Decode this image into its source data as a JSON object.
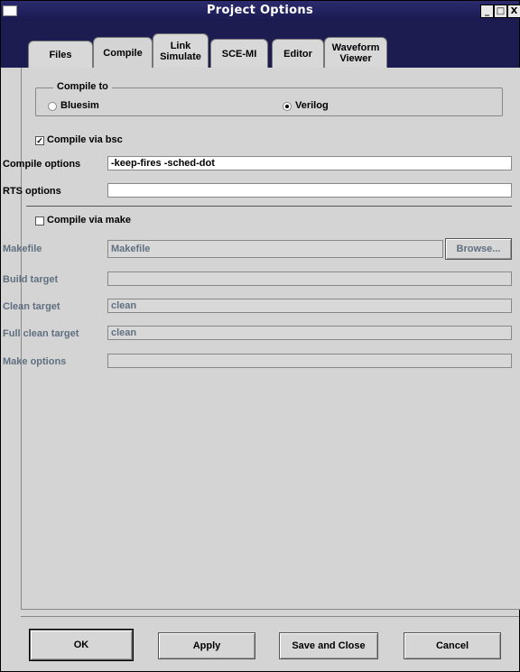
{
  "window": {
    "title": "Project Options",
    "controls": [
      "_",
      "□",
      "X"
    ]
  },
  "tabs": [
    {
      "label": "Files",
      "active": false
    },
    {
      "label": "Compile",
      "active": true
    },
    {
      "label": "Link Simulate",
      "active": false
    },
    {
      "label": "SCE-MI",
      "active": false
    },
    {
      "label": "Editor",
      "active": false
    },
    {
      "label": "Waveform Viewer",
      "active": false
    }
  ],
  "compile_to": {
    "legend": "Compile to",
    "option_bluesim": "Bluesim",
    "option_verilog": "Verilog",
    "selected": "Verilog"
  },
  "compile_via_bsc": {
    "label": "Compile via bsc",
    "checked": true,
    "check_mark": "✓"
  },
  "compile_options": {
    "label": "Compile options",
    "value": "-keep-fires -sched-dot"
  },
  "rts_options": {
    "label": "RTS options",
    "value": ""
  },
  "compile_via_make": {
    "label": "Compile via make",
    "checked": false
  },
  "makefile": {
    "label": "Makefile",
    "value": "Makefile",
    "browse_label": "Browse..."
  },
  "build_target": {
    "label": "Build target",
    "value": ""
  },
  "clean_target": {
    "label": "Clean target",
    "value": "clean"
  },
  "full_clean_target": {
    "label": "Full clean target",
    "value": "clean"
  },
  "make_options": {
    "label": "Make options",
    "value": ""
  },
  "buttons": {
    "ok": "OK",
    "apply": "Apply",
    "save_close": "Save and Close",
    "cancel": "Cancel"
  }
}
